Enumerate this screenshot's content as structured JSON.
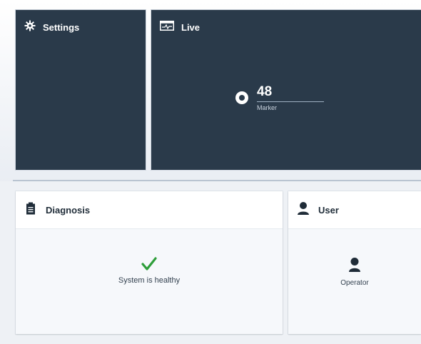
{
  "tiles": {
    "settings": {
      "title": "Settings",
      "icon": "gear-icon"
    },
    "live": {
      "title": "Live",
      "icon": "pulse-monitor-icon",
      "value": "48",
      "value_label": "Marker",
      "value_icon": "marker-icon"
    },
    "diagnosis": {
      "title": "Diagnosis",
      "icon": "clipboard-icon",
      "status_text": "System is healthy",
      "status_icon": "checkmark-icon",
      "status_color": "#2e9e3a"
    },
    "user": {
      "title": "User",
      "icon": "user-icon",
      "role": "Operator"
    }
  },
  "colors": {
    "tile_dark": "#2a3a4a",
    "tile_light": "#f6f8fb",
    "accent_check": "#2e9e3a"
  }
}
